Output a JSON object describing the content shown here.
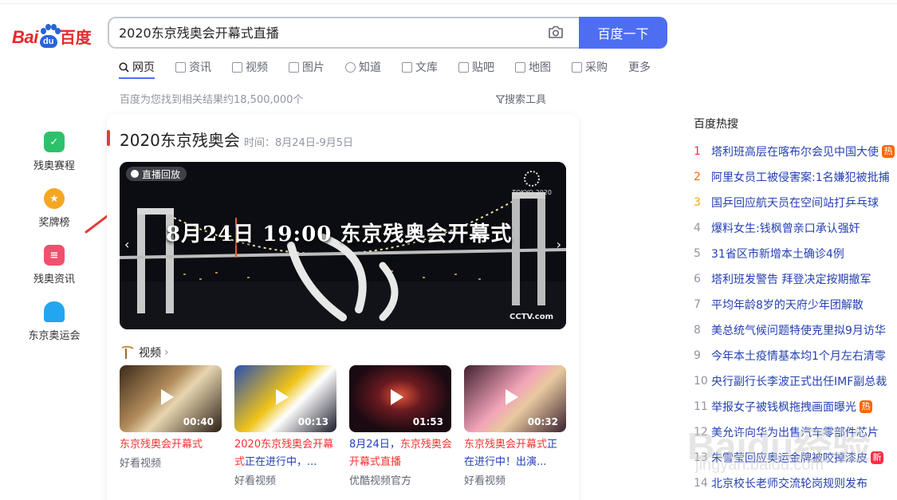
{
  "logo": {
    "part1": "Bai",
    "paw": "du",
    "part2": "百度"
  },
  "search": {
    "query": "2020东京残奥会开幕式直播",
    "button": "百度一下"
  },
  "tabs": [
    {
      "label": "网页"
    },
    {
      "label": "资讯"
    },
    {
      "label": "视频"
    },
    {
      "label": "图片"
    },
    {
      "label": "知道"
    },
    {
      "label": "文库"
    },
    {
      "label": "贴吧"
    },
    {
      "label": "地图"
    },
    {
      "label": "采购"
    },
    {
      "label": "更多"
    }
  ],
  "result_count": "百度为您找到相关结果约18,500,000个",
  "search_tools": "搜索工具",
  "left_nav": [
    {
      "label": "残奥赛程",
      "color": "#2ec16b"
    },
    {
      "label": "奖牌榜",
      "color": "#f5a623"
    },
    {
      "label": "残奥资讯",
      "color": "#f0506e"
    },
    {
      "label": "东京奥运会",
      "color": "#23a6f0"
    }
  ],
  "card": {
    "title": "2020东京残奥会",
    "time": "时间：8月24日-9月5日",
    "hero": {
      "badge": "直播回放",
      "overlay": "8月24日 19:00  东京残奥会开幕式",
      "logo": "TOKYO 2020",
      "channel": "CCTV.com"
    },
    "video_header": "视频",
    "videos": [
      {
        "duration": "00:40",
        "title_hl": "东京残奥会开幕式",
        "title_rest": "",
        "source": "好看视频"
      },
      {
        "duration": "00:13",
        "title_hl": "2020东京残奥会开幕式",
        "title_rest": "正在进行中，...",
        "source": "好看视频"
      },
      {
        "duration": "01:53",
        "title_pre": "8月24日，",
        "title_hl": "东京残奥会开幕式直播",
        "source": "优酷视频官方"
      },
      {
        "duration": "00:32",
        "title_hl": "东京残奥会开幕式",
        "title_rest": "正在进行中！出演...",
        "source": "好看视频"
      }
    ]
  },
  "hot": {
    "title": "百度热搜",
    "items": [
      {
        "rank": "1",
        "text": "塔利班高层在喀布尔会见中国大使",
        "tag": "热",
        "rank_color": "#fe2d46",
        "tag_color": "#ff6600"
      },
      {
        "rank": "2",
        "text": "阿里女员工被侵害案:1名嫌犯被批捕",
        "rank_color": "#f60"
      },
      {
        "rank": "3",
        "text": "国乒回应航天员在空间站打乒乓球",
        "rank_color": "#faa90e"
      },
      {
        "rank": "4",
        "text": "爆料女生:钱枫曾亲口承认强奸"
      },
      {
        "rank": "5",
        "text": "31省区市新增本土确诊4例"
      },
      {
        "rank": "6",
        "text": "塔利班发警告 拜登决定按期撤军"
      },
      {
        "rank": "7",
        "text": "平均年龄8岁的天府少年团解散"
      },
      {
        "rank": "8",
        "text": "美总统气候问题特使克里拟9月访华"
      },
      {
        "rank": "9",
        "text": "今年本土疫情基本均1个月左右清零"
      },
      {
        "rank": "10",
        "text": "央行副行长李波正式出任IMF副总裁"
      },
      {
        "rank": "11",
        "text": "举报女子被钱枫拖拽画面曝光",
        "tag": "热",
        "tag_color": "#ff6600"
      },
      {
        "rank": "12",
        "text": "美允许向华为出售汽车零部件芯片"
      },
      {
        "rank": "13",
        "text": "朱雪莹回应奥运金牌被咬掉漆皮",
        "tag": "新",
        "tag_color": "#fe2d46"
      },
      {
        "rank": "14",
        "text": "北京校长老师交流轮岗规则发布"
      }
    ]
  },
  "watermark": {
    "main": "Baidu经验",
    "sub": "jingyan.baidu.com"
  }
}
